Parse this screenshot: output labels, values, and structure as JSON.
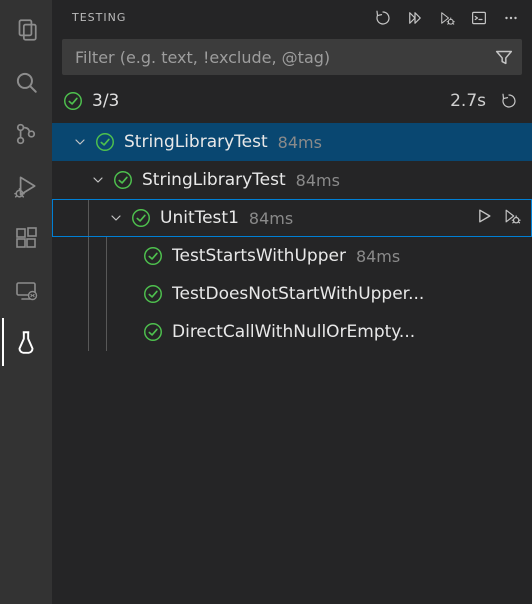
{
  "panel": {
    "title": "TESTING",
    "filter_placeholder": "Filter (e.g. text, !exclude, @tag)"
  },
  "summary": {
    "passed_text": "3/3",
    "duration": "2.7s"
  },
  "tree": {
    "root": {
      "name": "StringLibraryTest",
      "duration": "84ms"
    },
    "project": {
      "name": "StringLibraryTest",
      "duration": "84ms"
    },
    "class": {
      "name": "UnitTest1",
      "duration": "84ms"
    },
    "tests": [
      {
        "name": "TestStartsWithUpper",
        "duration": "84ms"
      },
      {
        "name": "TestDoesNotStartWithUpper...",
        "duration": ""
      },
      {
        "name": "DirectCallWithNullOrEmpty...",
        "duration": ""
      }
    ]
  }
}
